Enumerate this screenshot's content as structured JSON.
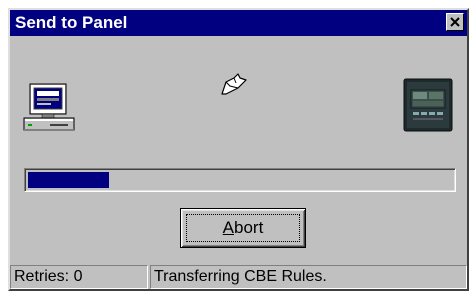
{
  "window": {
    "title": "Send to Panel",
    "close_icon": "close-icon"
  },
  "icons": {
    "source": "computer-icon",
    "packet": "data-packet-icon",
    "target": "fire-panel-icon"
  },
  "progress": {
    "fraction": 0.19
  },
  "buttons": {
    "abort_mnemonic": "A",
    "abort_rest": "bort"
  },
  "status": {
    "retries": "Retries: 0",
    "message": "Transferring CBE Rules."
  },
  "colors": {
    "titlebar": "#000080",
    "progress_fill": "#000080",
    "face": "#c0c0c0"
  }
}
